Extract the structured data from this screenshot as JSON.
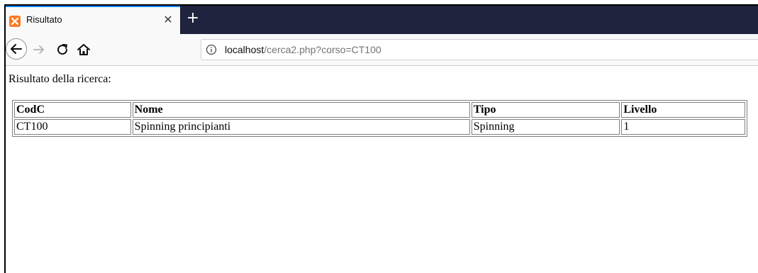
{
  "tab": {
    "title": "Risultato",
    "close_glyph": "✕",
    "newtab_glyph": "+",
    "icon": "xampp-favicon-icon",
    "icon_color": "#fb7a24"
  },
  "urlbar": {
    "host": "localhost",
    "path": "/cerca2.php?corso=CT100"
  },
  "nav": {
    "back_icon": "back-arrow-icon",
    "forward_icon": "forward-arrow-icon",
    "reload_icon": "reload-icon",
    "home_icon": "home-icon",
    "info_icon": "info-icon"
  },
  "page": {
    "heading": "Risultato della ricerca:",
    "table": {
      "headers": [
        "CodC",
        "Nome",
        "Tipo",
        "Livello"
      ],
      "rows": [
        [
          "CT100",
          "Spinning principianti",
          "Spinning",
          "1"
        ]
      ]
    }
  },
  "colors": {
    "tabstrip": "#20233e",
    "active_tab_accent": "#0a84ff"
  }
}
